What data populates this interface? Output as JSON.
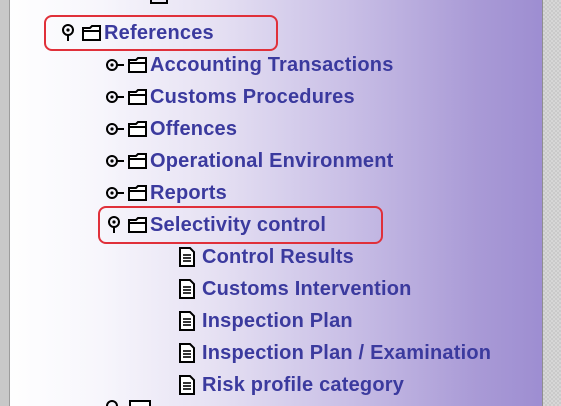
{
  "tree": {
    "root": {
      "label": "References",
      "expanded": true
    },
    "groups": [
      {
        "label": "Accounting Transactions",
        "expanded": false
      },
      {
        "label": "Customs Procedures",
        "expanded": false
      },
      {
        "label": "Offences",
        "expanded": false
      },
      {
        "label": "Operational Environment",
        "expanded": false
      },
      {
        "label": "Reports",
        "expanded": false
      },
      {
        "label": "Selectivity control",
        "expanded": true
      }
    ],
    "selectivity_children": [
      {
        "label": "Control Results"
      },
      {
        "label": "Customs Intervention"
      },
      {
        "label": "Inspection Plan"
      },
      {
        "label": "Inspection Plan / Examination"
      },
      {
        "label": "Risk profile category"
      }
    ]
  },
  "colors": {
    "label": "#3b3a9e",
    "highlight": "#e0303a"
  }
}
